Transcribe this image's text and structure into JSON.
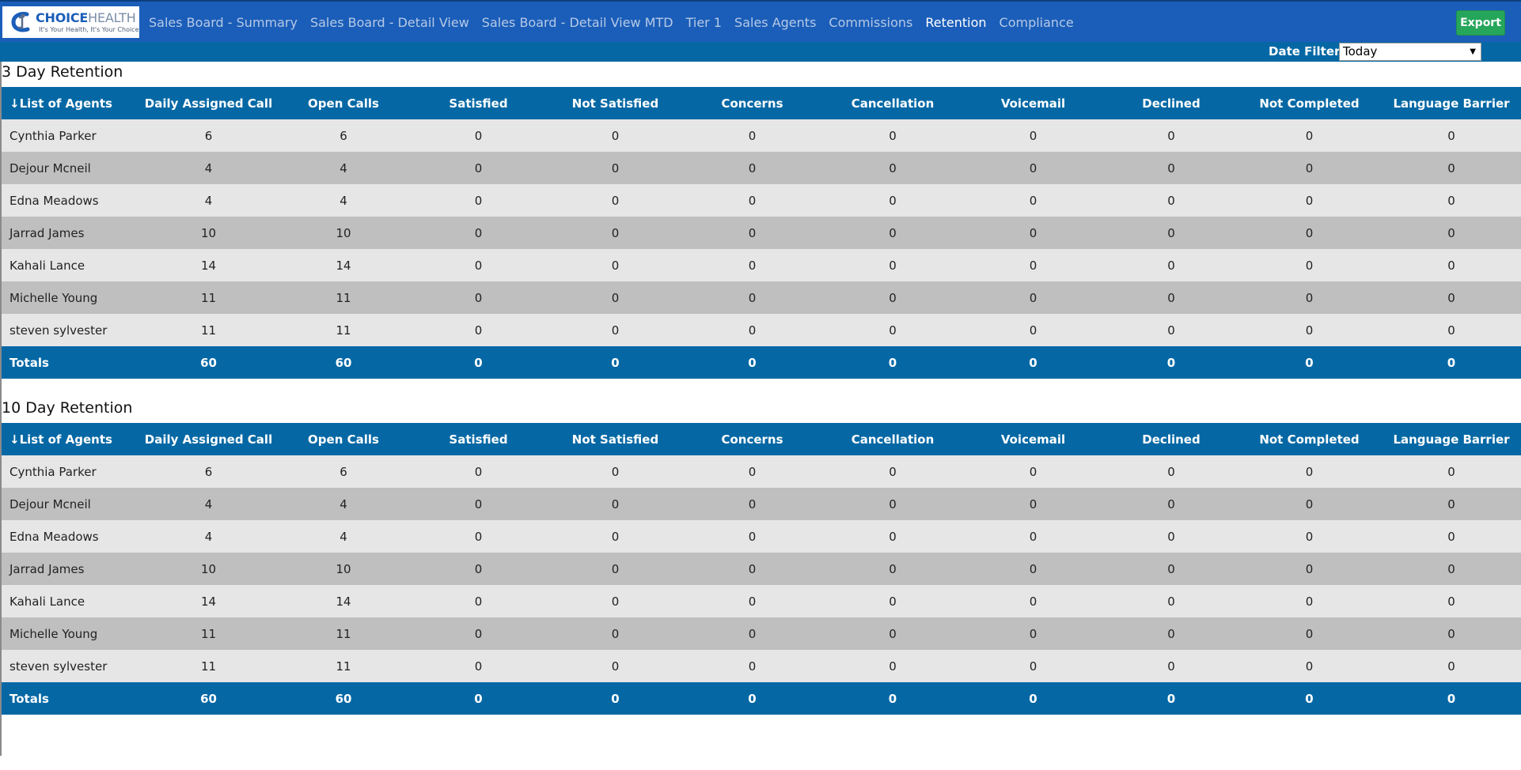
{
  "brand": {
    "name_bold": "CHOICE",
    "name_light": "HEALTH",
    "tagline": "It's Your Health, It's Your Choice",
    "logo_icon": "stylized-c-figure-icon"
  },
  "nav": {
    "links": [
      {
        "label": "Sales Board - Summary",
        "active": false
      },
      {
        "label": "Sales Board - Detail View",
        "active": false
      },
      {
        "label": "Sales Board - Detail View MTD",
        "active": false
      },
      {
        "label": "Tier 1",
        "active": false
      },
      {
        "label": "Sales Agents",
        "active": false
      },
      {
        "label": "Commissions",
        "active": false
      },
      {
        "label": "Retention",
        "active": true
      },
      {
        "label": "Compliance",
        "active": false
      }
    ],
    "export_label": "Export"
  },
  "filter": {
    "label": "Date Filter:",
    "value": "Today"
  },
  "colors": {
    "navbar": "#1b5eb9",
    "table_header": "#0568a5",
    "export_button": "#26a65b",
    "row_light": "#e6e6e6",
    "row_dark": "#c0bfbf"
  },
  "tables": [
    {
      "title": "3 Day Retention",
      "columns": [
        "↓List of Agents",
        "Daily Assigned Call",
        "Open Calls",
        "Satisfied",
        "Not Satisfied",
        "Concerns",
        "Cancellation",
        "Voicemail",
        "Declined",
        "Not Completed",
        "Language Barrier"
      ],
      "rows": [
        [
          "Cynthia Parker",
          "6",
          "6",
          "0",
          "0",
          "0",
          "0",
          "0",
          "0",
          "0",
          "0"
        ],
        [
          "Dejour Mcneil",
          "4",
          "4",
          "0",
          "0",
          "0",
          "0",
          "0",
          "0",
          "0",
          "0"
        ],
        [
          "Edna Meadows",
          "4",
          "4",
          "0",
          "0",
          "0",
          "0",
          "0",
          "0",
          "0",
          "0"
        ],
        [
          "Jarrad James",
          "10",
          "10",
          "0",
          "0",
          "0",
          "0",
          "0",
          "0",
          "0",
          "0"
        ],
        [
          "Kahali Lance",
          "14",
          "14",
          "0",
          "0",
          "0",
          "0",
          "0",
          "0",
          "0",
          "0"
        ],
        [
          "Michelle Young",
          "11",
          "11",
          "0",
          "0",
          "0",
          "0",
          "0",
          "0",
          "0",
          "0"
        ],
        [
          "steven sylvester",
          "11",
          "11",
          "0",
          "0",
          "0",
          "0",
          "0",
          "0",
          "0",
          "0"
        ]
      ],
      "totals": [
        "Totals",
        "60",
        "60",
        "0",
        "0",
        "0",
        "0",
        "0",
        "0",
        "0",
        "0"
      ]
    },
    {
      "title": "10 Day Retention",
      "columns": [
        "↓List of Agents",
        "Daily Assigned Call",
        "Open Calls",
        "Satisfied",
        "Not Satisfied",
        "Concerns",
        "Cancellation",
        "Voicemail",
        "Declined",
        "Not Completed",
        "Language Barrier"
      ],
      "rows": [
        [
          "Cynthia Parker",
          "6",
          "6",
          "0",
          "0",
          "0",
          "0",
          "0",
          "0",
          "0",
          "0"
        ],
        [
          "Dejour Mcneil",
          "4",
          "4",
          "0",
          "0",
          "0",
          "0",
          "0",
          "0",
          "0",
          "0"
        ],
        [
          "Edna Meadows",
          "4",
          "4",
          "0",
          "0",
          "0",
          "0",
          "0",
          "0",
          "0",
          "0"
        ],
        [
          "Jarrad James",
          "10",
          "10",
          "0",
          "0",
          "0",
          "0",
          "0",
          "0",
          "0",
          "0"
        ],
        [
          "Kahali Lance",
          "14",
          "14",
          "0",
          "0",
          "0",
          "0",
          "0",
          "0",
          "0",
          "0"
        ],
        [
          "Michelle Young",
          "11",
          "11",
          "0",
          "0",
          "0",
          "0",
          "0",
          "0",
          "0",
          "0"
        ],
        [
          "steven sylvester",
          "11",
          "11",
          "0",
          "0",
          "0",
          "0",
          "0",
          "0",
          "0",
          "0"
        ]
      ],
      "totals": [
        "Totals",
        "60",
        "60",
        "0",
        "0",
        "0",
        "0",
        "0",
        "0",
        "0",
        "0"
      ]
    }
  ]
}
